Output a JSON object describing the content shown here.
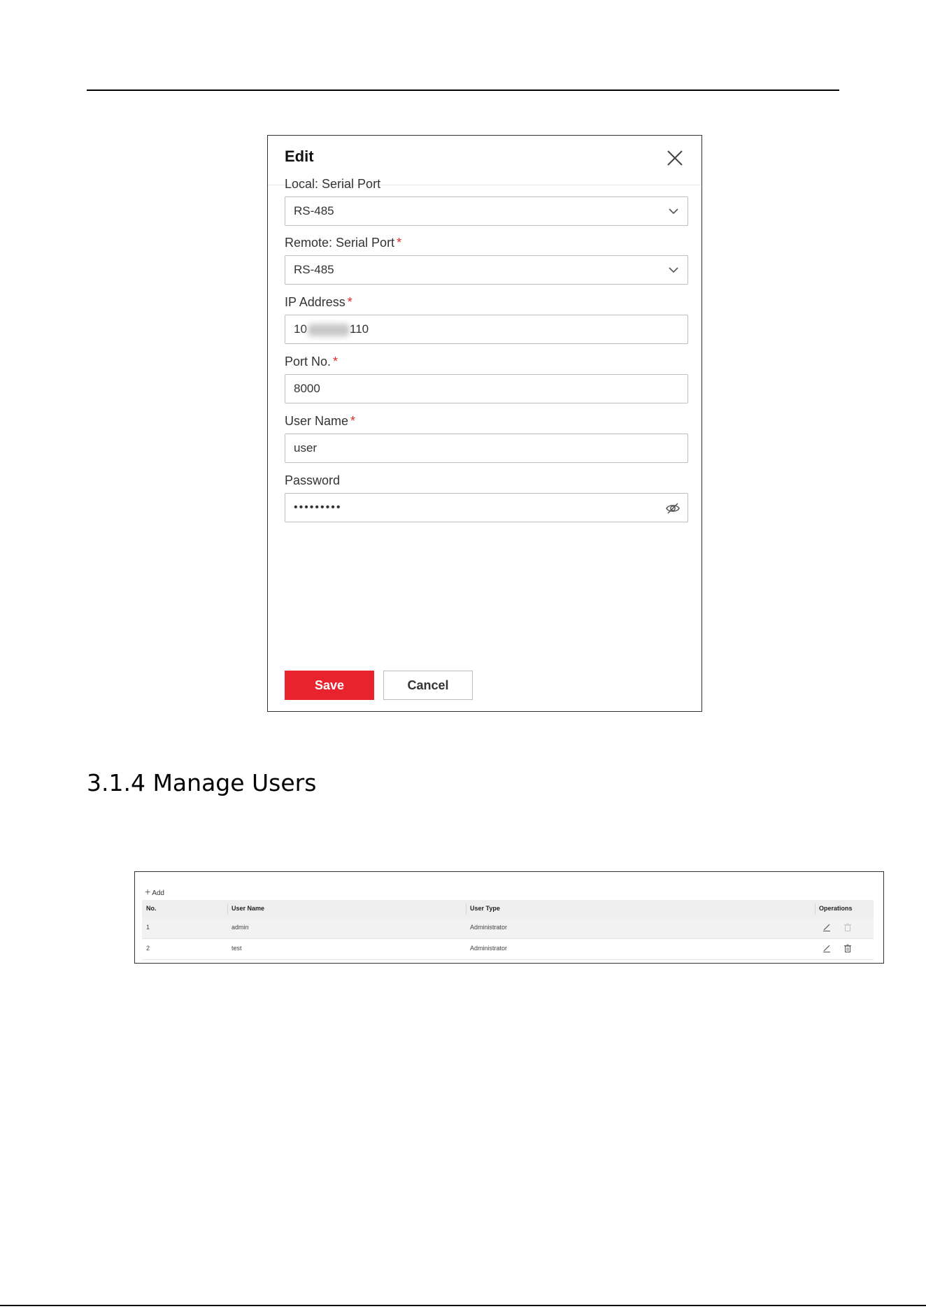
{
  "dialog": {
    "title": "Edit",
    "fields": [
      {
        "label": "Local: Serial Port",
        "required": false,
        "value": "RS-485",
        "type": "select"
      },
      {
        "label": "Remote: Serial Port",
        "required": true,
        "value": "RS-485",
        "type": "select"
      },
      {
        "label": "IP Address",
        "required": true,
        "value_prefix": "10",
        "value_suffix": "110",
        "type": "text"
      },
      {
        "label": "Port No.",
        "required": true,
        "value": "8000",
        "type": "text"
      },
      {
        "label": "User Name",
        "required": true,
        "value": "user",
        "type": "text"
      },
      {
        "label": "Password",
        "required": false,
        "value": "•••••••••",
        "type": "password"
      }
    ],
    "required_mark": "*",
    "save_label": "Save",
    "cancel_label": "Cancel"
  },
  "section": {
    "heading": "3.1.4 Manage Users"
  },
  "users_table": {
    "add_label": "Add",
    "headers": [
      "No.",
      "User Name",
      "User Type",
      "Operations"
    ],
    "rows": [
      {
        "no": "1",
        "user_name": "admin",
        "user_type": "Administrator"
      },
      {
        "no": "2",
        "user_name": "test",
        "user_type": "Administrator"
      }
    ]
  },
  "colors": {
    "accent_red": "#e8232d",
    "required_red": "#e02a2a"
  }
}
